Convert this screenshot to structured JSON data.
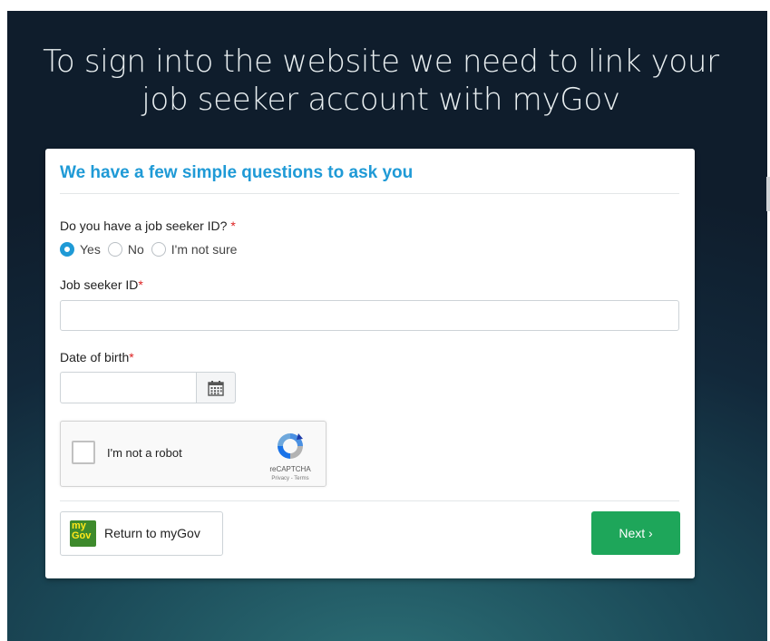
{
  "header": {
    "line1": "To sign into the website we need to link your",
    "line2": "job seeker account with myGov"
  },
  "form": {
    "title": "We have a few simple questions to ask you",
    "question": "Do you have a job seeker ID?",
    "required_mark": "*",
    "options": [
      {
        "label": "Yes",
        "checked": true
      },
      {
        "label": "No",
        "checked": false
      },
      {
        "label": "I'm not sure",
        "checked": false
      }
    ],
    "jobseeker_id_label": "Job seeker ID",
    "jobseeker_id_value": "",
    "dob_label": "Date of birth",
    "dob_value": "",
    "calendar_icon": "calendar-icon"
  },
  "captcha": {
    "label": "I'm not a robot",
    "brand": "reCAPTCHA",
    "terms": "Privacy - Terms",
    "checked": false
  },
  "buttons": {
    "return_label": "Return to myGov",
    "logo_line1": "my",
    "logo_line2": "Gov",
    "next_label": "Next ›"
  },
  "colors": {
    "accent": "#1f9ad6",
    "next_button": "#1ea65a",
    "required": "#dd2222",
    "mygov_green": "#3e8a2c"
  }
}
